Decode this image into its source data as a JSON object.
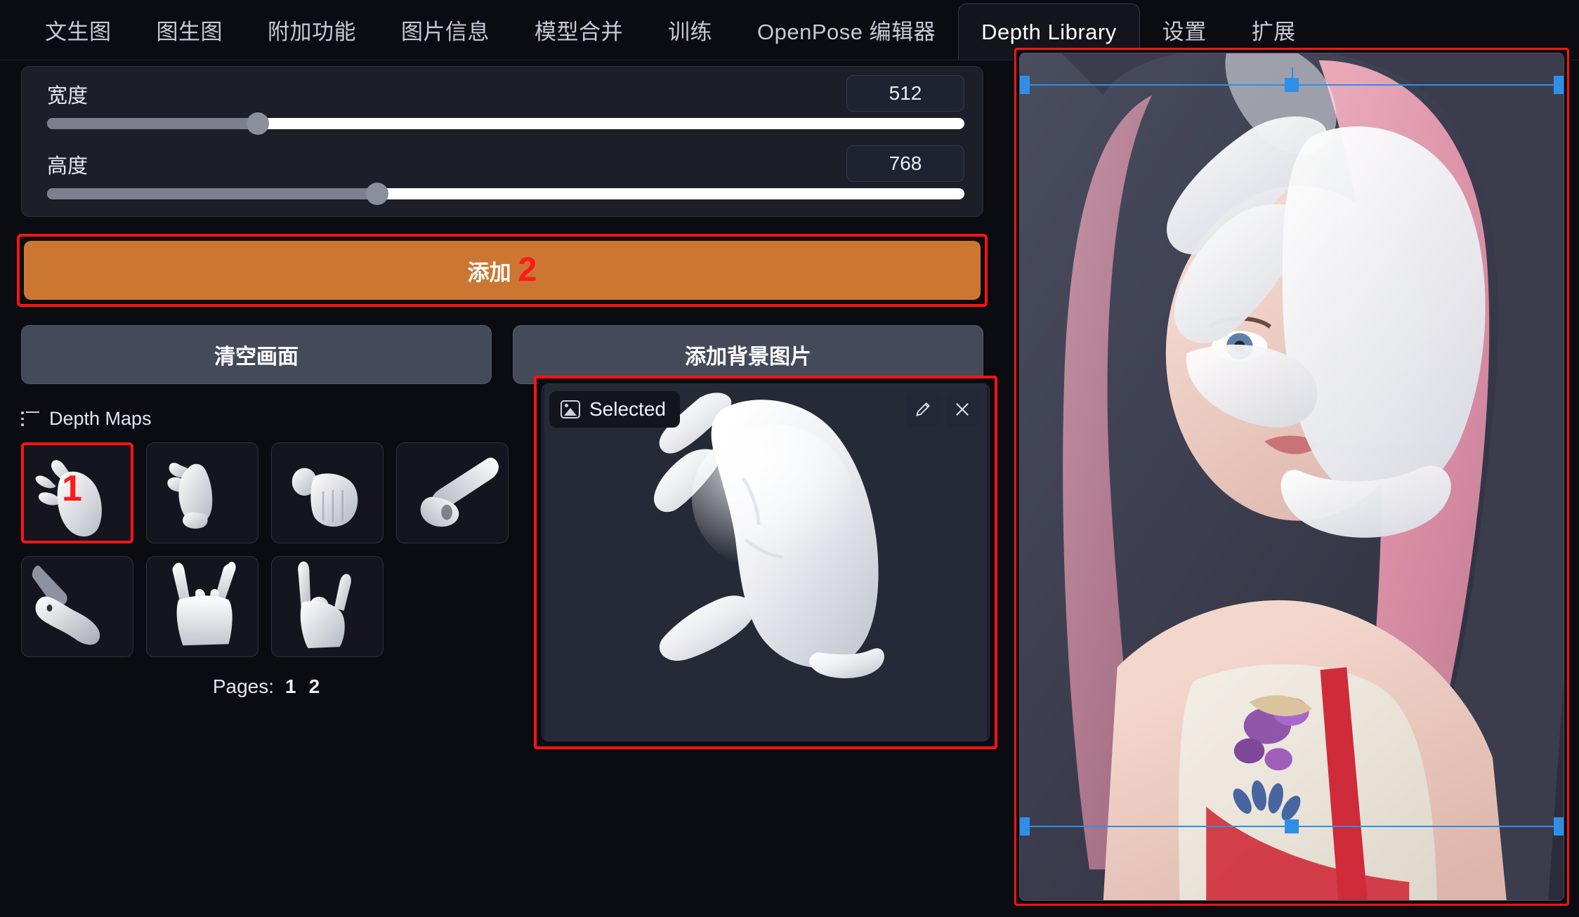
{
  "tabs": [
    {
      "label": "文生图",
      "active": false
    },
    {
      "label": "图生图",
      "active": false
    },
    {
      "label": "附加功能",
      "active": false
    },
    {
      "label": "图片信息",
      "active": false
    },
    {
      "label": "模型合并",
      "active": false
    },
    {
      "label": "训练",
      "active": false
    },
    {
      "label": "OpenPose 编辑器",
      "active": false
    },
    {
      "label": "Depth Library",
      "active": true
    },
    {
      "label": "设置",
      "active": false
    },
    {
      "label": "扩展",
      "active": false
    }
  ],
  "size_panel": {
    "width": {
      "label": "宽度",
      "value": "512",
      "fill_percent": 23
    },
    "height": {
      "label": "高度",
      "value": "768",
      "fill_percent": 36
    }
  },
  "primary_action": {
    "label": "添加",
    "annotation": "2",
    "color": "#cb7731",
    "highlight_color": "#ff1414"
  },
  "actions": [
    {
      "label": "清空画面"
    },
    {
      "label": "添加背景图片"
    }
  ],
  "depth_maps": {
    "title": "Depth Maps",
    "icon": "list-icon",
    "selected_index": 0,
    "selected_annotation": "1",
    "items": [
      {
        "name": "hand-pinch-side"
      },
      {
        "name": "hand-claw-angled"
      },
      {
        "name": "hand-fist-thumb-up"
      },
      {
        "name": "hand-point-index"
      },
      {
        "name": "hand-point-down"
      },
      {
        "name": "hand-rock-horns-front"
      },
      {
        "name": "hand-rock-horns-side"
      }
    ],
    "pagination": {
      "label": "Pages:",
      "pages": [
        "1",
        "2"
      ],
      "current": "1"
    }
  },
  "selected_panel": {
    "badge_label": "Selected",
    "badge_icon": "image-icon",
    "edit_icon": "pencil-icon",
    "close_icon": "close-icon",
    "highlight_color": "#ff1414",
    "image_name": "hand-pinch-side-depth-map"
  },
  "preview": {
    "highlight_color": "#ff1414",
    "selection_color": "#2f8fe6",
    "image_name": "cosplay-photo-with-hand-overlay",
    "handles": 6
  }
}
